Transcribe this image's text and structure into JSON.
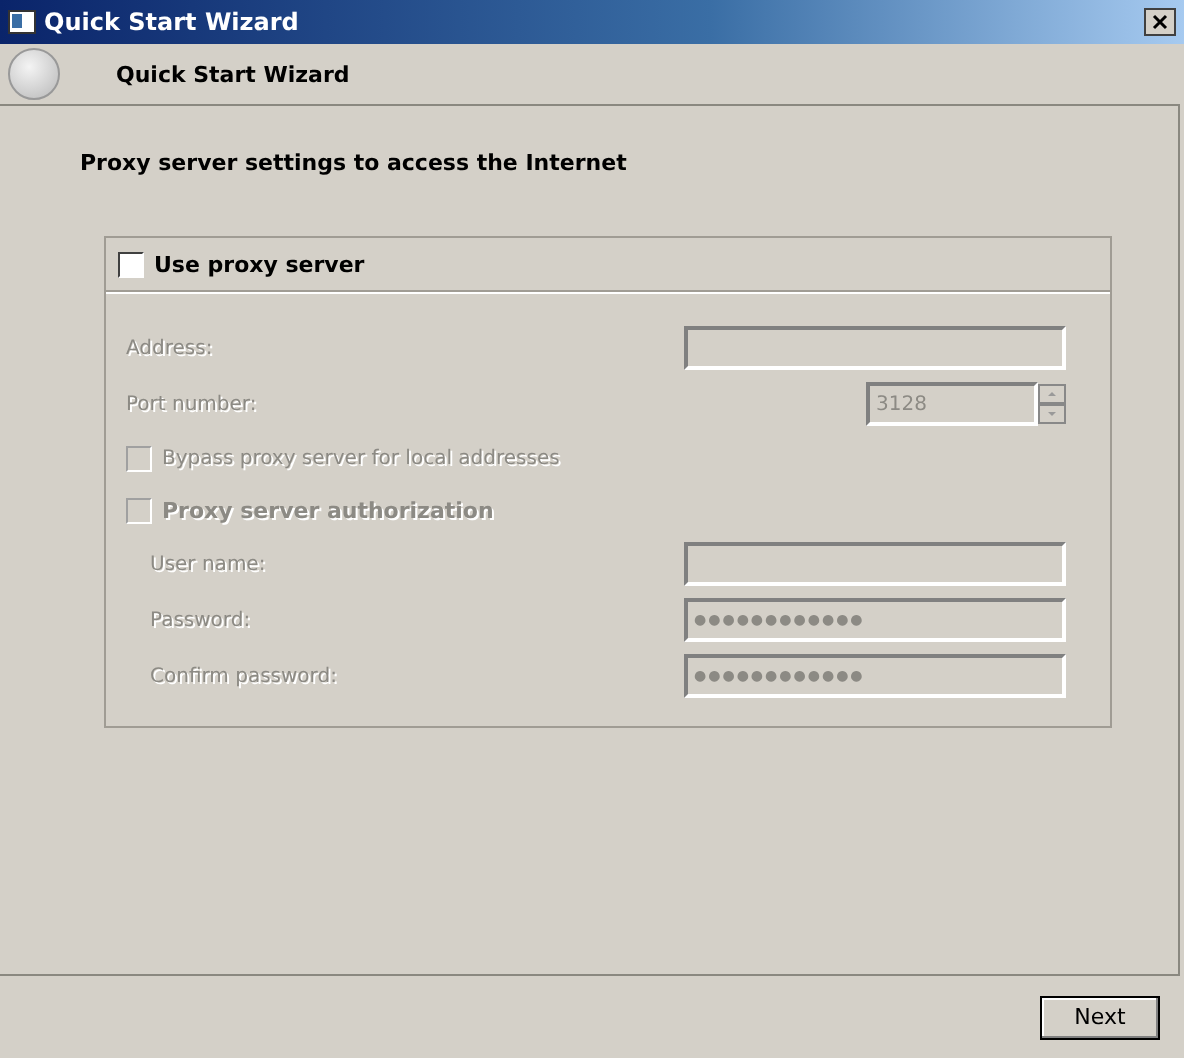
{
  "window": {
    "title": "Quick Start Wizard"
  },
  "header": {
    "title": "Quick Start Wizard"
  },
  "page_title": "Proxy server settings to access the Internet",
  "use_proxy": {
    "label": "Use proxy server",
    "checked": false
  },
  "fields": [
    {
      "kind": "text",
      "label": "Address:",
      "disabled": true
    },
    {
      "kind": "spin",
      "label": "Port number:",
      "value": "3128",
      "disabled": true
    }
  ],
  "options": [
    {
      "label": "Bypass proxy server for local addresses",
      "checked": false,
      "disabled": true,
      "bold": false
    },
    {
      "label": "Proxy server authorization",
      "checked": false,
      "disabled": true,
      "bold": true
    }
  ],
  "auth_fields": [
    {
      "kind": "text",
      "label": "User name:",
      "disabled": true
    },
    {
      "kind": "password",
      "label": "Password:",
      "value": "●●●●●●●●●●●●",
      "disabled": true
    },
    {
      "kind": "password",
      "label": "Confirm password:",
      "value": "●●●●●●●●●●●●",
      "disabled": true
    }
  ],
  "buttons": [
    {
      "label": "Next"
    }
  ]
}
